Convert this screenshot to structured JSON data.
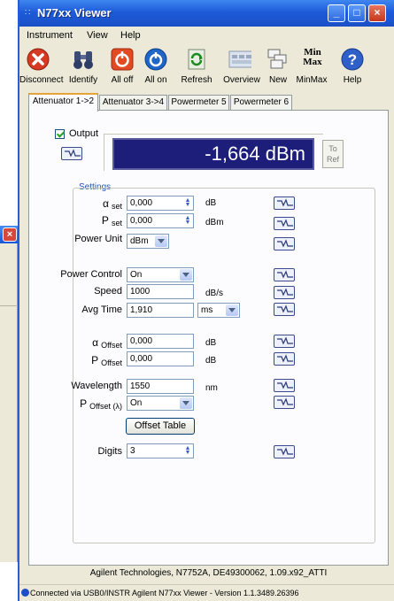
{
  "window": {
    "title": "N77xx Viewer"
  },
  "menu": [
    "Instrument",
    "View",
    "Help"
  ],
  "toolbar": [
    {
      "label": "Disconnect",
      "icon": "disconnect-icon"
    },
    {
      "label": "Identify",
      "icon": "binoculars-icon"
    },
    {
      "label": "All off",
      "icon": "power-red-icon"
    },
    {
      "label": "All on",
      "icon": "power-blue-icon"
    },
    {
      "label": "Refresh",
      "icon": "refresh-icon"
    },
    {
      "label": "Overview",
      "icon": "overview-icon"
    },
    {
      "label": "New",
      "icon": "new-window-icon"
    },
    {
      "label": "MinMax",
      "icon": "minmax-icon",
      "icon_text": [
        "Min",
        "Max"
      ]
    },
    {
      "label": "Help",
      "icon": "help-icon"
    }
  ],
  "tabs": [
    "Attenuator 1->2",
    "Attenuator 3->4",
    "Powermeter 5",
    "Powermeter 6"
  ],
  "active_tab": 0,
  "output": {
    "label": "Output",
    "checked": true,
    "value": "-1,664 dBm",
    "to_ref": [
      "To",
      "Ref"
    ]
  },
  "settings": {
    "title": "Settings",
    "alpha_set": {
      "symbol": "α",
      "sub": "set",
      "value": "0,000",
      "unit": "dB"
    },
    "p_set": {
      "symbol": "P",
      "sub": "set",
      "value": "0,000",
      "unit": "dBm"
    },
    "power_unit": {
      "label": "Power Unit",
      "value": "dBm"
    },
    "power_control": {
      "label": "Power Control",
      "value": "On"
    },
    "speed": {
      "label": "Speed",
      "value": "1000",
      "unit": "dB/s"
    },
    "avg_time": {
      "label": "Avg Time",
      "value": "1,910",
      "unit": "ms"
    },
    "alpha_offset": {
      "symbol": "α",
      "sub": "Offset",
      "value": "0,000",
      "unit": "dB"
    },
    "p_offset": {
      "symbol": "P",
      "sub": "Offset",
      "value": "0,000",
      "unit": "dB"
    },
    "wavelength": {
      "label": "Wavelength",
      "value": "1550",
      "unit": "nm"
    },
    "p_offset_lambda": {
      "symbol": "P",
      "sub": "Offset (λ)",
      "value": "On"
    },
    "offset_table_button": "Offset Table",
    "digits": {
      "label": "Digits",
      "value": "3"
    }
  },
  "device_info": "Agilent Technologies, N7752A, DE49300062, 1.09.x92_ATTI",
  "statusbar": "Connected via USB0/INSTR  Agilent N77xx Viewer - Version 1.1.3489.26396",
  "colors": {
    "title_bar": "#1d5bd9",
    "display_bg": "#1d1d7a",
    "window_bg": "#ece9d8",
    "accent_tab": "#e8a23a"
  }
}
